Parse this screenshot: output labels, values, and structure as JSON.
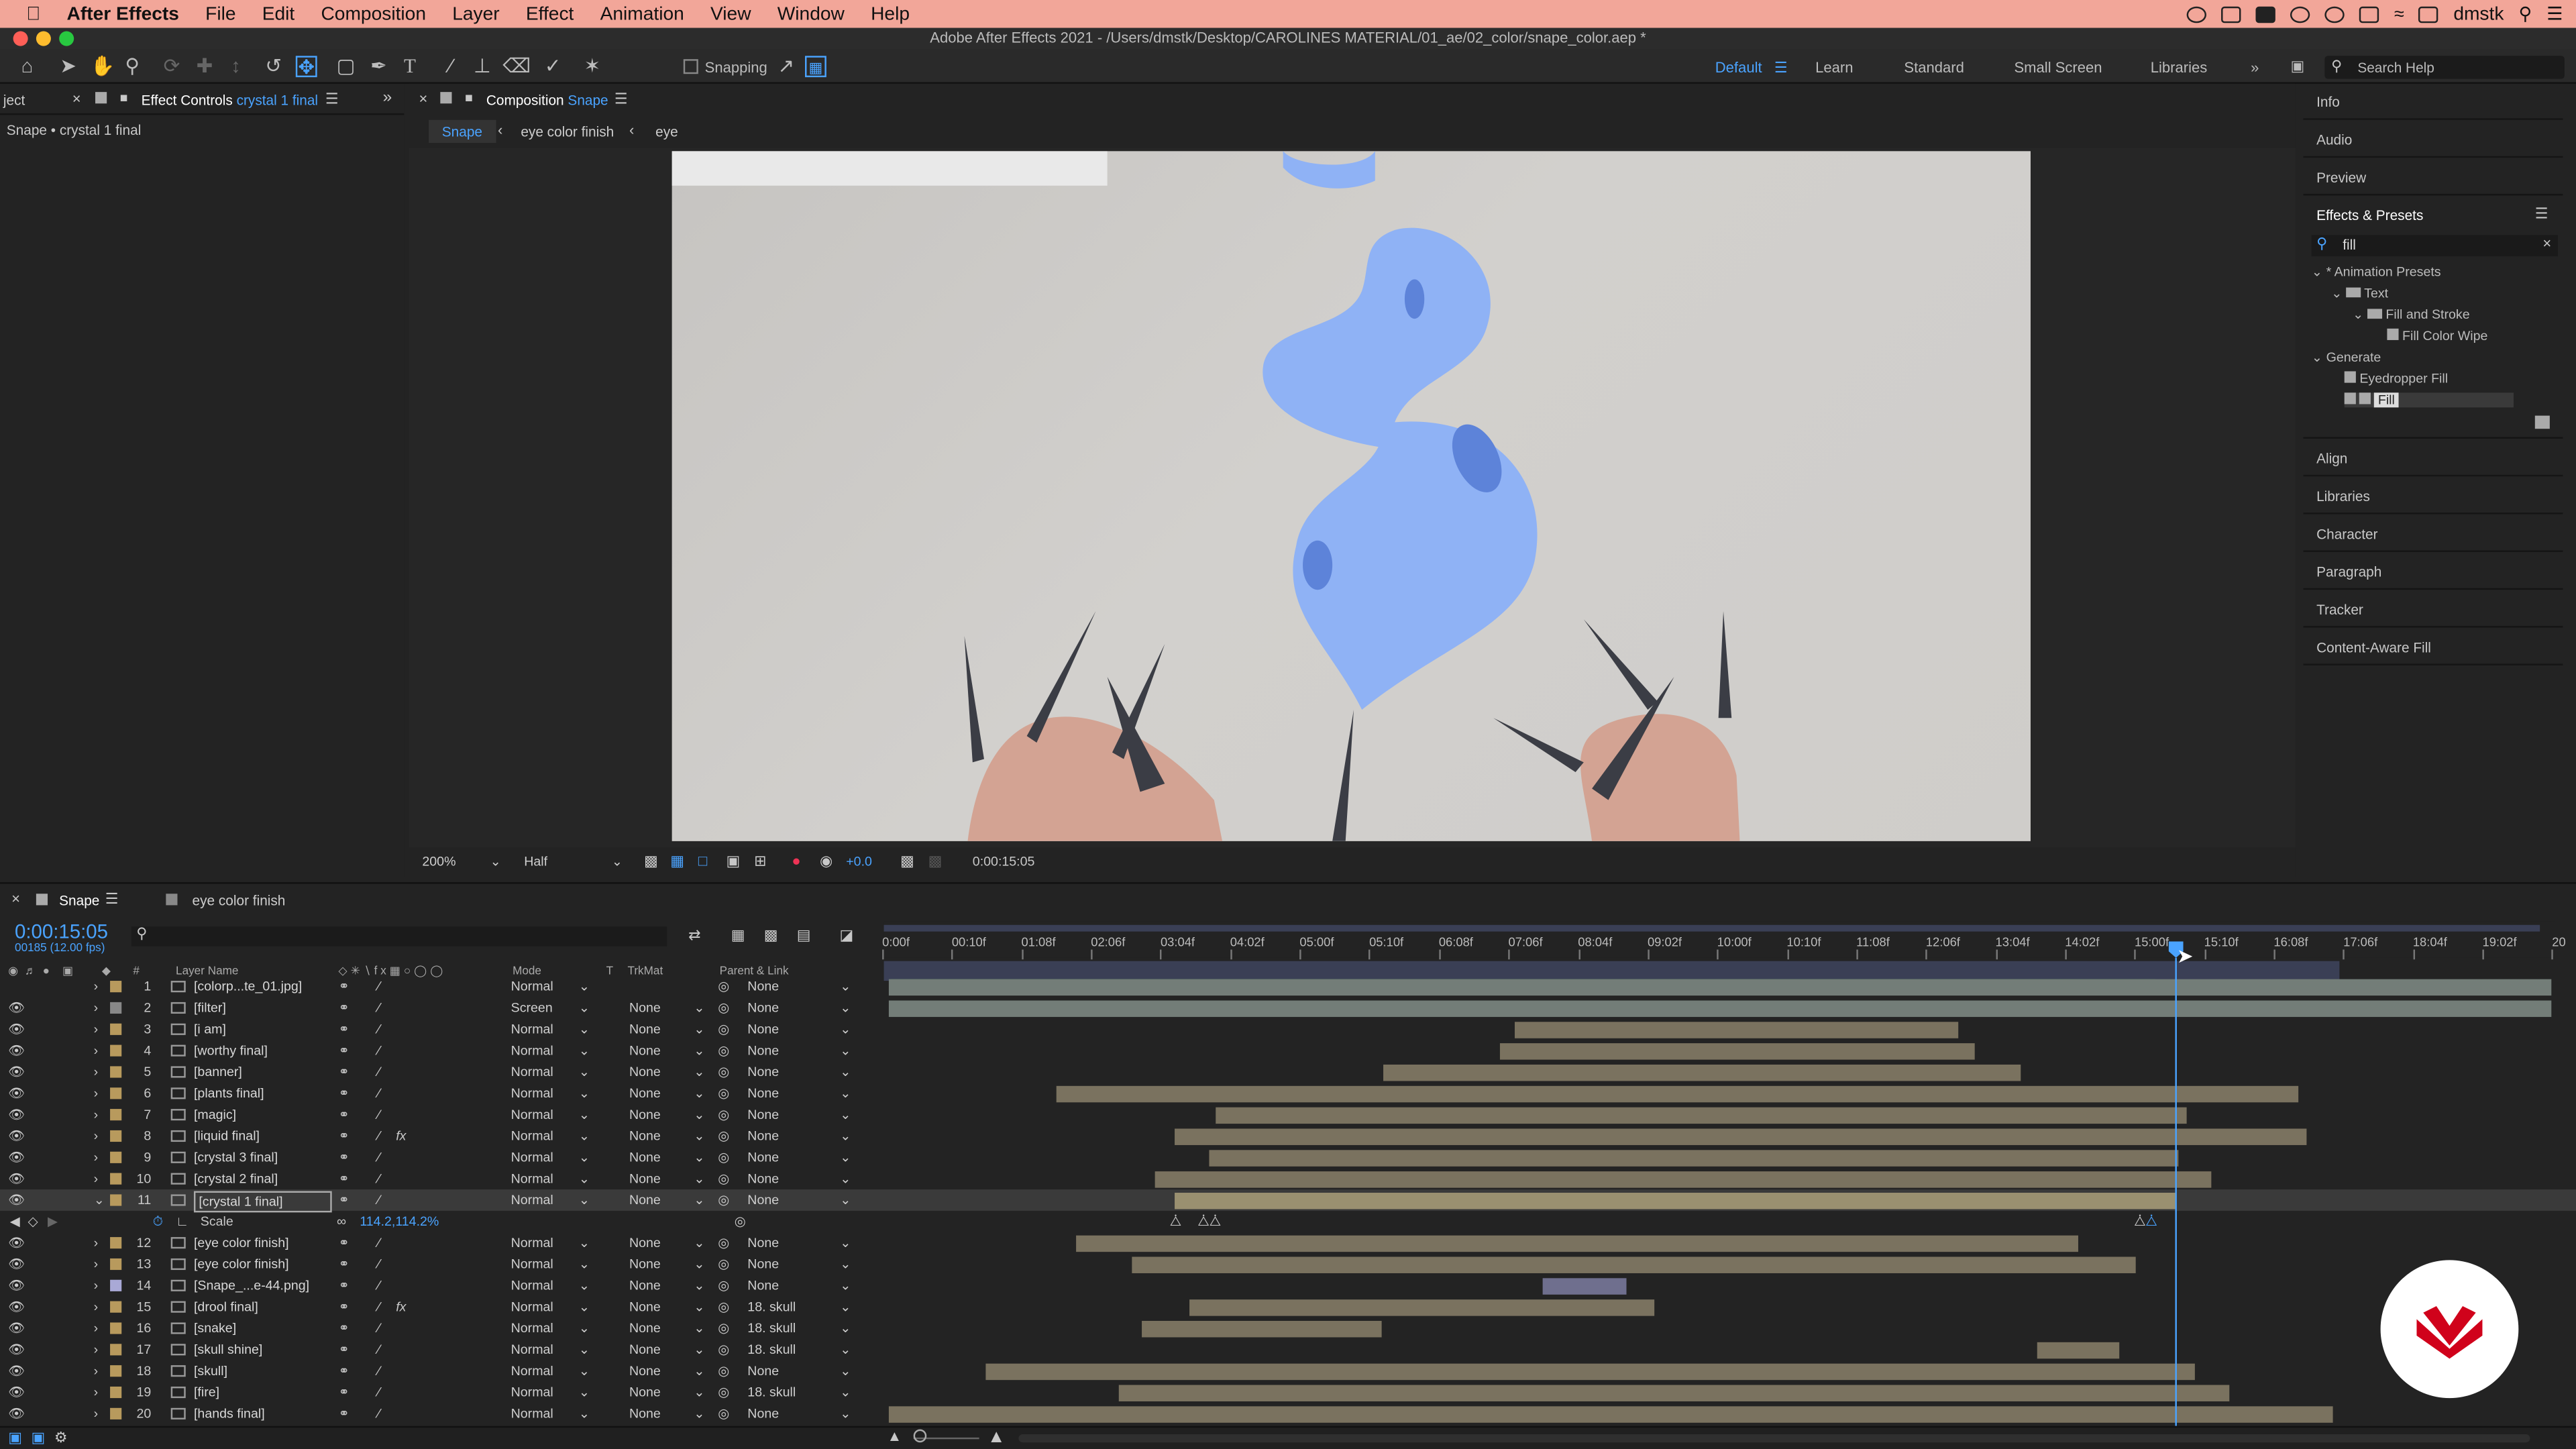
{
  "menubar": {
    "apple": "",
    "app": "After Effects",
    "items": [
      "File",
      "Edit",
      "Composition",
      "Layer",
      "Effect",
      "Animation",
      "View",
      "Window",
      "Help"
    ],
    "user": "dmstk"
  },
  "window_title": "Adobe After Effects 2021 - /Users/dmstk/Desktop/CAROLINES MATERIAL/01_ae/02_color/snape_color.aep *",
  "toolbar": {
    "snapping": "Snapping",
    "workspaces": [
      "Default",
      "Learn",
      "Standard",
      "Small Screen",
      "Libraries"
    ],
    "search_placeholder": "Search Help"
  },
  "project_panel": {
    "tab_partial": "ject",
    "effect_controls_label": "Effect Controls",
    "effect_controls_layer": "crystal 1 final",
    "breadcrumb": "Snape • crystal 1 final"
  },
  "comp_panel": {
    "tab_label": "Composition",
    "tab_comp": "Snape",
    "flow": [
      "Snape",
      "eye color finish",
      "eye"
    ],
    "zoom": "200%",
    "resolution": "Half",
    "exposure": "+0.0",
    "timecode": "0:00:15:05"
  },
  "right_panel": {
    "items_top": [
      "Info",
      "Audio",
      "Preview"
    ],
    "effects_title": "Effects & Presets",
    "search_value": "fill",
    "tree": [
      {
        "label": "* Animation Presets",
        "level": 0
      },
      {
        "label": "Text",
        "level": 1
      },
      {
        "label": "Fill and Stroke",
        "level": 2
      },
      {
        "label": "Fill Color Wipe",
        "level": 3
      },
      {
        "label": "Generate",
        "level": 0
      },
      {
        "label": "Eyedropper Fill",
        "level": 1
      },
      {
        "label": "Fill",
        "level": 1
      }
    ],
    "items_bottom": [
      "Align",
      "Libraries",
      "Character",
      "Paragraph",
      "Tracker",
      "Content-Aware Fill"
    ]
  },
  "timeline": {
    "tab_active": "Snape",
    "tab_other": "eye color finish",
    "timecode": "0:00:15:05",
    "fps": "00185 (12.00 fps)",
    "col_layer_name": "Layer Name",
    "col_mode": "Mode",
    "col_t": "T",
    "col_trkmat": "TrkMat",
    "col_parent": "Parent & Link",
    "ruler": [
      "0:00f",
      "00:10f",
      "01:08f",
      "02:06f",
      "03:04f",
      "04:02f",
      "05:00f",
      "05:10f",
      "06:08f",
      "07:06f",
      "08:04f",
      "09:02f",
      "10:00f",
      "10:10f",
      "11:08f",
      "12:06f",
      "13:04f",
      "14:02f",
      "15:00f",
      "15:10f",
      "16:08f",
      "17:06f",
      "18:04f",
      "19:02f",
      "20"
    ],
    "layers": [
      {
        "num": "1",
        "name": "[colorp...te_01.jpg]",
        "mode": "Normal",
        "trkmat": "",
        "parent": "None",
        "fx": false
      },
      {
        "num": "2",
        "name": "[filter]",
        "mode": "Screen",
        "trkmat": "None",
        "parent": "None",
        "fx": false
      },
      {
        "num": "3",
        "name": "[i am]",
        "mode": "Normal",
        "trkmat": "None",
        "parent": "None",
        "fx": false
      },
      {
        "num": "4",
        "name": "[worthy final]",
        "mode": "Normal",
        "trkmat": "None",
        "parent": "None",
        "fx": false
      },
      {
        "num": "5",
        "name": "[banner]",
        "mode": "Normal",
        "trkmat": "None",
        "parent": "None",
        "fx": false
      },
      {
        "num": "6",
        "name": "[plants final]",
        "mode": "Normal",
        "trkmat": "None",
        "parent": "None",
        "fx": false
      },
      {
        "num": "7",
        "name": "[magic]",
        "mode": "Normal",
        "trkmat": "None",
        "parent": "None",
        "fx": false
      },
      {
        "num": "8",
        "name": "[liquid final]",
        "mode": "Normal",
        "trkmat": "None",
        "parent": "None",
        "fx": true
      },
      {
        "num": "9",
        "name": "[crystal 3 final]",
        "mode": "Normal",
        "trkmat": "None",
        "parent": "None",
        "fx": false
      },
      {
        "num": "10",
        "name": "[crystal 2 final]",
        "mode": "Normal",
        "trkmat": "None",
        "parent": "None",
        "fx": false
      },
      {
        "num": "11",
        "name": "[crystal 1 final]",
        "mode": "Normal",
        "trkmat": "None",
        "parent": "None",
        "fx": false
      },
      {
        "num": "12",
        "name": "[eye color finish]",
        "mode": "Normal",
        "trkmat": "None",
        "parent": "None",
        "fx": false
      },
      {
        "num": "13",
        "name": "[eye color finish]",
        "mode": "Normal",
        "trkmat": "None",
        "parent": "None",
        "fx": false
      },
      {
        "num": "14",
        "name": "[Snape_...e-44.png]",
        "mode": "Normal",
        "trkmat": "None",
        "parent": "None",
        "fx": false
      },
      {
        "num": "15",
        "name": "[drool final]",
        "mode": "Normal",
        "trkmat": "None",
        "parent": "18. skull",
        "fx": true
      },
      {
        "num": "16",
        "name": "[snake]",
        "mode": "Normal",
        "trkmat": "None",
        "parent": "18. skull",
        "fx": false
      },
      {
        "num": "17",
        "name": "[skull shine]",
        "mode": "Normal",
        "trkmat": "None",
        "parent": "18. skull",
        "fx": false
      },
      {
        "num": "18",
        "name": "[skull]",
        "mode": "Normal",
        "trkmat": "None",
        "parent": "None",
        "fx": false
      },
      {
        "num": "19",
        "name": "[fire]",
        "mode": "Normal",
        "trkmat": "None",
        "parent": "18. skull",
        "fx": false
      },
      {
        "num": "20",
        "name": "[hands final]",
        "mode": "Normal",
        "trkmat": "None",
        "parent": "None",
        "fx": false
      }
    ],
    "scale_property": {
      "label": "Scale",
      "value": "114.2,114.2%"
    }
  },
  "colors": {
    "accent": "#4aa3ff",
    "menubar": "#f2a699",
    "layer_bar": "#7a725f",
    "logo_red": "#d0021b"
  }
}
